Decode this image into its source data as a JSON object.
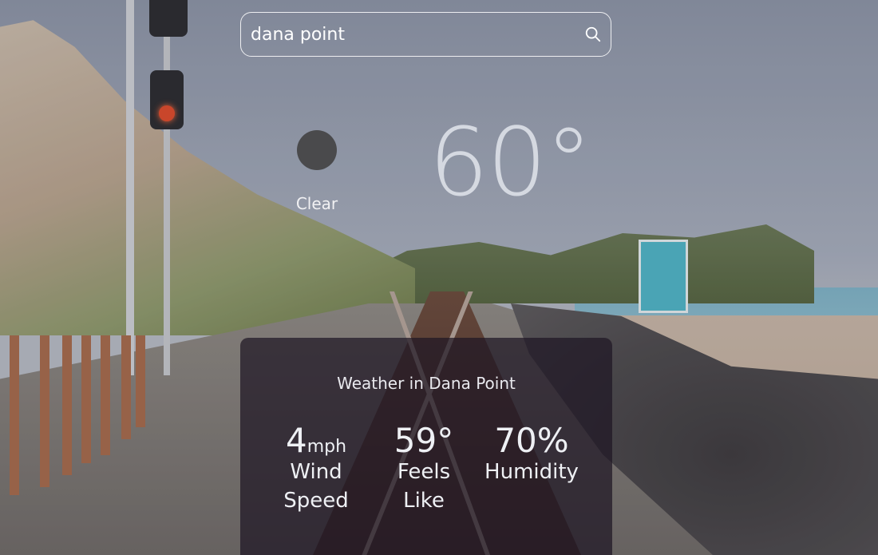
{
  "search": {
    "value": "dana point",
    "placeholder": "Search"
  },
  "current": {
    "condition": "Clear",
    "temperature": "60°"
  },
  "details": {
    "title": "Weather in Dana Point",
    "wind": {
      "value": "4",
      "unit": "mph",
      "label_line1": "Wind",
      "label_line2": "Speed"
    },
    "feels": {
      "value": "59°",
      "label_line1": "Feels",
      "label_line2": "Like"
    },
    "humidity": {
      "value": "70%",
      "label": "Humidity"
    }
  },
  "icons": {
    "search": "search-icon",
    "condition": "weather-condition-icon"
  }
}
